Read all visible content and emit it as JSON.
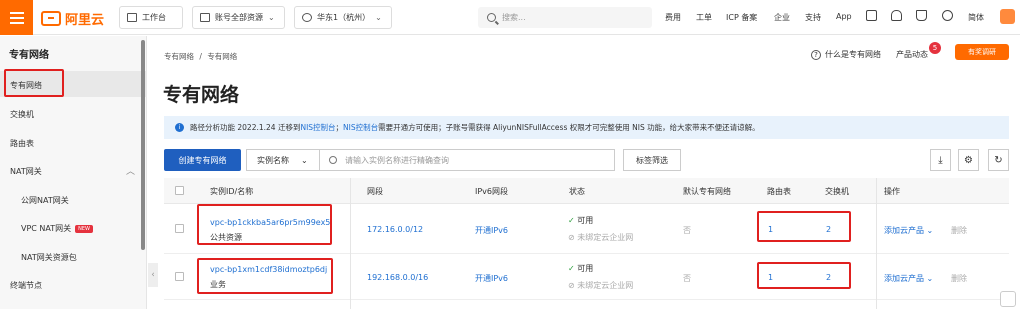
{
  "topbar": {
    "logo_text": "阿里云",
    "workbench": "工作台",
    "account": "账号全部资源",
    "region": "华东1（杭州）",
    "search_placeholder": "搜索...",
    "nav": [
      "费用",
      "工单",
      "ICP 备案",
      "企业",
      "支持",
      "App"
    ],
    "lang": "简体"
  },
  "sidebar": {
    "title": "专有网络",
    "items": [
      {
        "label": "专有网络"
      },
      {
        "label": "交换机"
      },
      {
        "label": "路由表"
      },
      {
        "label": "NAT网关"
      },
      {
        "label": "公网NAT网关"
      },
      {
        "label": "VPC NAT网关",
        "badge": "NEW"
      },
      {
        "label": "NAT网关资源包"
      },
      {
        "label": "终端节点"
      }
    ]
  },
  "breadcrumb": {
    "root": "专有网络",
    "sep": "/",
    "current": "专有网络"
  },
  "page_title": "专有网络",
  "header_actions": {
    "help": "什么是专有网络",
    "dynamics": "产品动态",
    "badge": "5",
    "survey": "有奖调研"
  },
  "notice": {
    "prefix": "路径分析功能 2022.1.24 迁移到",
    "link1": "NIS控制台",
    "sep": "；",
    "link2": "NIS控制台",
    "suffix": "需要开通方可使用；子账号需获得 AliyunNISFullAccess 权限才可完整使用 NIS 功能，给大家带来不便还请谅解。"
  },
  "toolbar": {
    "create": "创建专有网络",
    "filter_field": "实例名称",
    "search_placeholder": "请输入实例名称进行精确查询",
    "tag_filter": "标签筛选"
  },
  "table": {
    "headers": [
      "实例ID/名称",
      "网段",
      "IPv6网段",
      "状态",
      "默认专有网络",
      "路由表",
      "交换机",
      "操作"
    ],
    "rows": [
      {
        "id": "vpc-bp1ckkba5ar6pr5m99ex5",
        "name": "公共资源",
        "cidr": "172.16.0.0/12",
        "ipv6": "开通IPv6",
        "status": "可用",
        "cen": "未绑定云企业网",
        "default": "否",
        "route_tables": "1",
        "vswitches": "2",
        "action": "添加云产品",
        "delete": "删除"
      },
      {
        "id": "vpc-bp1xm1cdf38idmoztp6dj",
        "name": "业务",
        "cidr": "192.168.0.0/16",
        "ipv6": "开通IPv6",
        "status": "可用",
        "cen": "未绑定云企业网",
        "default": "否",
        "route_tables": "1",
        "vswitches": "2",
        "action": "添加云产品",
        "delete": "删除"
      }
    ]
  },
  "colors": {
    "brand": "#ff6a00",
    "primary": "#1f5fbf",
    "link": "#1f6fd1",
    "highlight": "#e0201f",
    "ok": "#2a9d3b"
  }
}
